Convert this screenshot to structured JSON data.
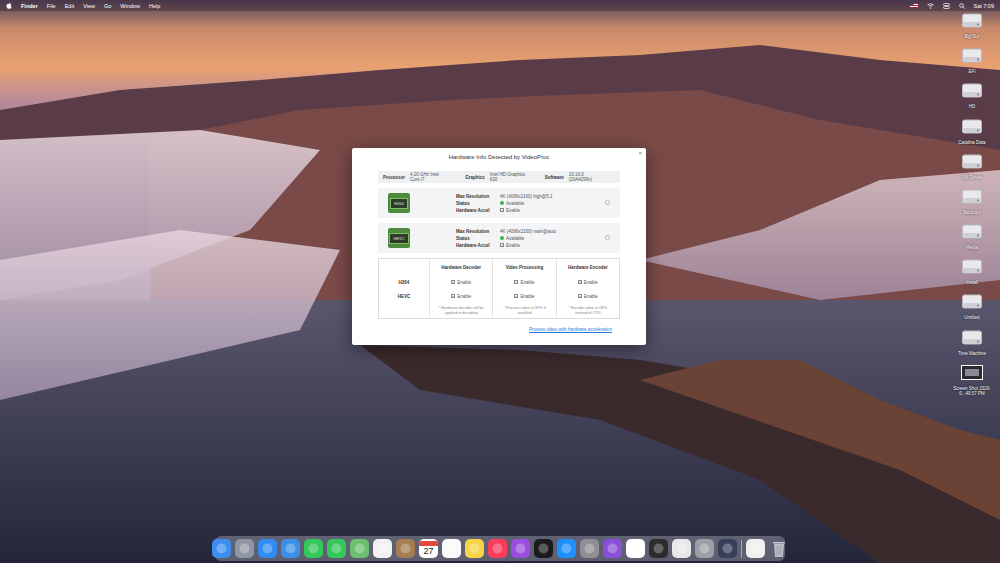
{
  "menu_bar": {
    "items": [
      {
        "label": "Finder",
        "selected": true
      },
      {
        "label": "File",
        "selected": false
      },
      {
        "label": "Edit",
        "selected": false
      },
      {
        "label": "View",
        "selected": false
      },
      {
        "label": "Go",
        "selected": false
      },
      {
        "label": "Window",
        "selected": false
      },
      {
        "label": "Help",
        "selected": false
      }
    ],
    "clock": "Sat 7:09"
  },
  "desktop_icons": [
    {
      "label": "Big Sur",
      "kind": "drive"
    },
    {
      "label": "EFI",
      "kind": "drive"
    },
    {
      "label": "HD",
      "kind": "drive"
    },
    {
      "label": "Catalina Data",
      "kind": "drive"
    },
    {
      "label": "VM Drives",
      "kind": "drive"
    },
    {
      "label": "Backups",
      "kind": "drive"
    },
    {
      "label": "Media",
      "kind": "drive"
    },
    {
      "label": "Install",
      "kind": "drive"
    },
    {
      "label": "Untitled",
      "kind": "drive"
    },
    {
      "label": "Time Machine",
      "kind": "drive"
    },
    {
      "label": "Screen Shot 2020-0...49.57 PM",
      "kind": "screenshot"
    }
  ],
  "dialog": {
    "title": "Hardware Info Detected by VideoProc",
    "close": "×",
    "info": [
      {
        "label": "Processor",
        "value": "4.20 GHz Intel Core i7"
      },
      {
        "label": "Graphics",
        "value": "Intel HD Graphics 630"
      },
      {
        "label": "Software",
        "value": "10.16.0 (20A4299v)"
      }
    ],
    "codecs": [
      {
        "chip": "H264",
        "rows": [
          {
            "label": "Max Resolution",
            "value": "4K (4096x2160) high@5.1",
            "kind": "text"
          },
          {
            "label": "Status",
            "value": "Available",
            "kind": "status",
            "color": "#3cb44b"
          },
          {
            "label": "Hardware Accel",
            "value": "Enable",
            "kind": "checkbox",
            "checked": true
          }
        ]
      },
      {
        "chip": "HEVC",
        "rows": [
          {
            "label": "Max Resolution",
            "value": "4K (4096x2160) main@auto",
            "kind": "text"
          },
          {
            "label": "Status",
            "value": "Available",
            "kind": "status",
            "color": "#3cb44b"
          },
          {
            "label": "Hardware Accel",
            "value": "Enable",
            "kind": "checkbox",
            "checked": true
          }
        ]
      }
    ],
    "table": {
      "columns": [
        "Hardware Decoder",
        "Video Processing",
        "Hardware Encoder"
      ],
      "rows": [
        {
          "label": "H264",
          "cells": [
            {
              "text": "Enable",
              "checked": true
            },
            {
              "text": "Enable",
              "checked": true
            },
            {
              "text": "Enable",
              "checked": true
            }
          ]
        },
        {
          "label": "HEVC",
          "cells": [
            {
              "text": "Enable",
              "checked": true
            },
            {
              "text": "Enable",
              "checked": true
            },
            {
              "text": "Enable",
              "checked": true
            }
          ]
        }
      ],
      "notes": [
        "* Hardware decoder will be applied in decoding",
        "* Process video in GPU if enabled",
        "* Encode video in GPU instead of CPU"
      ]
    },
    "link": "Process video with hardware acceleration"
  },
  "dock": {
    "items": [
      {
        "kind": "app",
        "color": "#3d8ef0"
      },
      {
        "kind": "app",
        "color": "#8f96a3"
      },
      {
        "kind": "app",
        "color": "#2f8cf2"
      },
      {
        "kind": "app",
        "color": "#3b8fe8"
      },
      {
        "kind": "app",
        "color": "#34c759"
      },
      {
        "kind": "app",
        "color": "#34c759"
      },
      {
        "kind": "app",
        "color": "#6cc070"
      },
      {
        "kind": "app",
        "color": "#f2f2f2"
      },
      {
        "kind": "app",
        "color": "#a67c52"
      },
      {
        "kind": "calendar",
        "color": "#ffffff",
        "day": "27"
      },
      {
        "kind": "app",
        "color": "#fafafa"
      },
      {
        "kind": "app",
        "color": "#f5d547"
      },
      {
        "kind": "app",
        "color": "#fb3c5a"
      },
      {
        "kind": "app",
        "color": "#9b4dde"
      },
      {
        "kind": "app",
        "color": "#1c1c1e"
      },
      {
        "kind": "app",
        "color": "#1e90ff"
      },
      {
        "kind": "app",
        "color": "#8e8e93"
      },
      {
        "kind": "app",
        "color": "#8a4fd8"
      },
      {
        "kind": "app",
        "color": "#ffffff"
      },
      {
        "kind": "app",
        "color": "#2b2b2b"
      },
      {
        "kind": "app",
        "color": "#e8e8e8"
      },
      {
        "kind": "app",
        "color": "#9aa0a6"
      },
      {
        "kind": "app",
        "color": "#3a3f58"
      },
      {
        "kind": "separator",
        "color": "#ffffff"
      },
      {
        "kind": "app",
        "color": "#f0f0f0"
      },
      {
        "kind": "trash",
        "color": "#c9ccd4"
      }
    ]
  }
}
